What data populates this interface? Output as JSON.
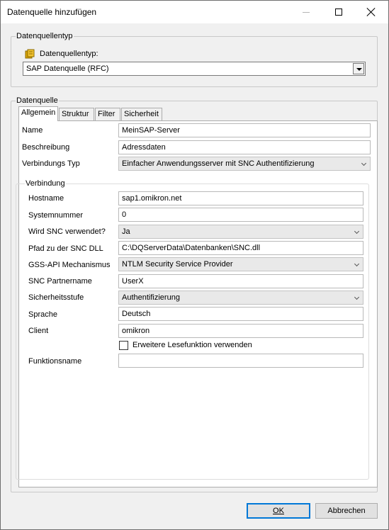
{
  "window": {
    "title": "Datenquelle hinzufügen"
  },
  "type_group": {
    "legend": "Datenquellentyp",
    "field_label": "Datenquellentyp:",
    "field_icon": "database-icon",
    "selected": "SAP Datenquelle (RFC)"
  },
  "source_group": {
    "legend": "Datenquelle",
    "tabs": [
      "Allgemein",
      "Struktur",
      "Filter",
      "Sicherheit"
    ],
    "active_tab": "Allgemein",
    "general": {
      "name_label": "Name",
      "name_value": "MeinSAP-Server",
      "desc_label": "Beschreibung",
      "desc_value": "Adressdaten",
      "conn_type_label": "Verbindungs Typ",
      "conn_type_value": "Einfacher Anwendungsserver mit SNC Authentifizierung"
    },
    "connection": {
      "legend": "Verbindung",
      "hostname_label": "Hostname",
      "hostname_value": "sap1.omikron.net",
      "sysnum_label": "Systemnummer",
      "sysnum_value": "0",
      "snc_used_label": "Wird SNC verwendet?",
      "snc_used_value": "Ja",
      "snc_dll_label": "Pfad zu der SNC DLL",
      "snc_dll_value": "C:\\DQServerData\\Datenbanken\\SNC.dll",
      "gss_label": "GSS-API Mechanismus",
      "gss_value": "NTLM Security Service Provider",
      "snc_partner_label": "SNC Partnername",
      "snc_partner_value": "UserX",
      "security_label": "Sicherheitsstufe",
      "security_value": "Authentifizierung",
      "language_label": "Sprache",
      "language_value": "Deutsch",
      "client_label": "Client",
      "client_value": "omikron",
      "extended_read_label": "Erweitere Lesefunktion verwenden",
      "extended_read_checked": false,
      "function_label": "Funktionsname",
      "function_value": ""
    }
  },
  "buttons": {
    "ok_label": "OK",
    "cancel_label": "Abbrechen"
  }
}
